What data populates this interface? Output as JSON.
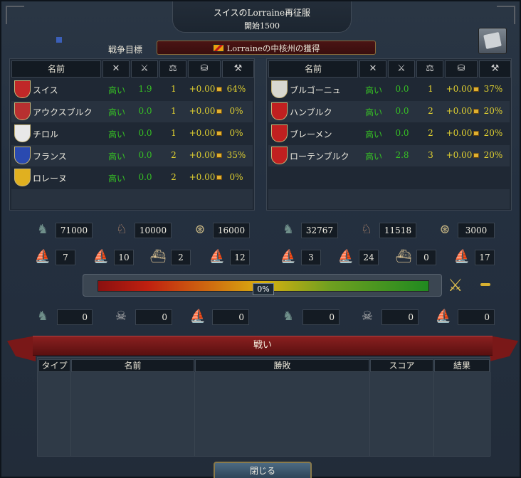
{
  "title": {
    "line1": "スイスのLorraine再征服",
    "line2": "開始1500"
  },
  "goal": {
    "label": "戦争目標",
    "value": "Lorraineの中核州の獲得"
  },
  "side_headers": [
    "名前"
  ],
  "attackers": [
    {
      "name": "スイス",
      "shield": "#c02828",
      "morale": "高い",
      "mil": "1.9",
      "weight": "1",
      "loans": "+0.00",
      "contribution": "64%",
      "leader": true
    },
    {
      "name": "アウクスブルク",
      "shield": "#b83030",
      "morale": "高い",
      "mil": "0.0",
      "weight": "1",
      "loans": "+0.00",
      "contribution": "0%"
    },
    {
      "name": "チロル",
      "shield": "#e8e8e8",
      "morale": "高い",
      "mil": "0.0",
      "weight": "1",
      "loans": "+0.00",
      "contribution": "0%"
    },
    {
      "name": "フランス",
      "shield": "#2a4ab0",
      "morale": "高い",
      "mil": "0.0",
      "weight": "2",
      "loans": "+0.00",
      "contribution": "35%"
    },
    {
      "name": "ロレーヌ",
      "shield": "#e0b020",
      "morale": "高い",
      "mil": "0.0",
      "weight": "2",
      "loans": "+0.00",
      "contribution": "0%"
    }
  ],
  "defenders": [
    {
      "name": "ブルゴーニュ",
      "shield": "#d8d8d0",
      "morale": "高い",
      "mil": "0.0",
      "weight": "1",
      "loans": "+0.00",
      "contribution": "37%",
      "leader": true
    },
    {
      "name": "ハンブルク",
      "shield": "#c02020",
      "morale": "高い",
      "mil": "0.0",
      "weight": "2",
      "loans": "+0.00",
      "contribution": "20%"
    },
    {
      "name": "ブレーメン",
      "shield": "#c02020",
      "morale": "高い",
      "mil": "0.0",
      "weight": "2",
      "loans": "+0.00",
      "contribution": "20%"
    },
    {
      "name": "ローテンブルク",
      "shield": "#c02020",
      "morale": "高い",
      "mil": "2.8",
      "weight": "3",
      "loans": "+0.00",
      "contribution": "20%"
    }
  ],
  "attacker_forces": {
    "infantry": "71000",
    "cavalry": "10000",
    "artillery": "16000",
    "heavy_ships": "7",
    "light_ships": "10",
    "galleys": "2",
    "transports": "12"
  },
  "defender_forces": {
    "infantry": "32767",
    "cavalry": "11518",
    "artillery": "3000",
    "heavy_ships": "3",
    "light_ships": "24",
    "galleys": "0",
    "transports": "17"
  },
  "warscore": {
    "value": "0%",
    "fraction": 0.5
  },
  "attacker_losses": {
    "land": "0",
    "attrition": "0",
    "naval": "0"
  },
  "defender_losses": {
    "land": "0",
    "attrition": "0",
    "naval": "0"
  },
  "battles": {
    "banner": "戦い",
    "columns": [
      "タイプ",
      "名前",
      "勝敗",
      "スコア",
      "結果"
    ]
  },
  "close_label": "閉じる",
  "icons": {
    "crossed-swords": "⚔",
    "morale": "flag-icon",
    "balance": "⚖"
  },
  "colors": {
    "positive": "#36c024",
    "neutral": "#e0d030",
    "banner": "#8a2020"
  }
}
